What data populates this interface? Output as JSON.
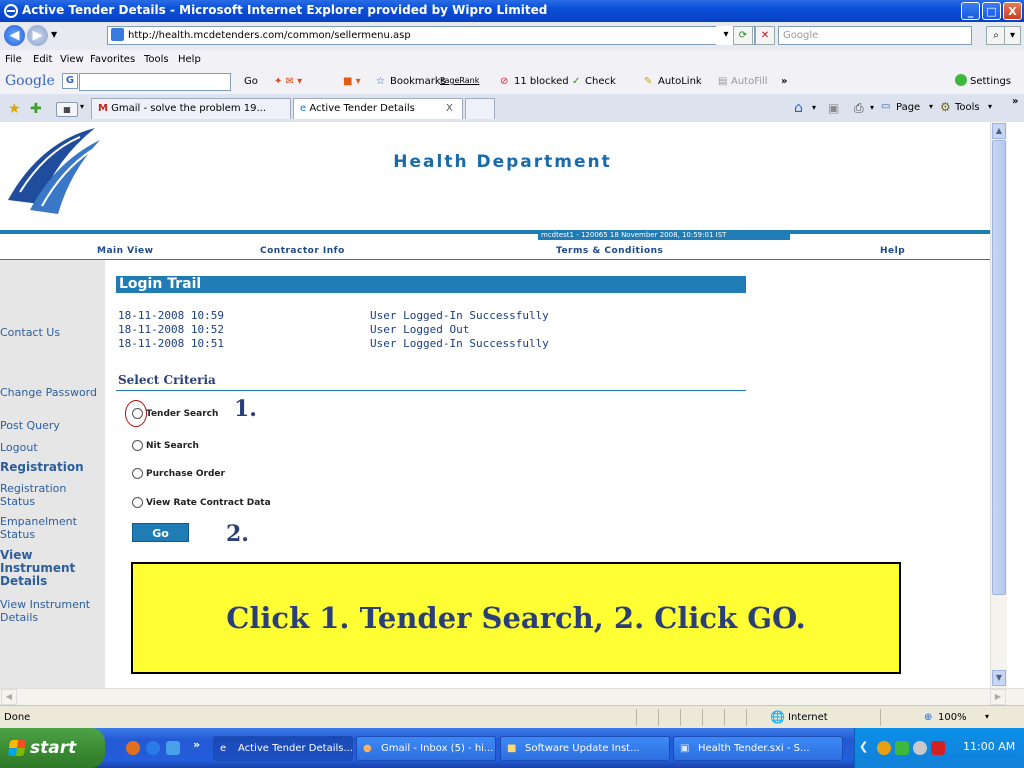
{
  "window": {
    "title": "Active Tender Details - Microsoft Internet Explorer provided by Wipro Limited",
    "minimize": "_",
    "maximize": "□",
    "close": "X"
  },
  "address": {
    "url": "http://health.mcdetenders.com/common/sellermenu.asp",
    "search_placeholder": "Google"
  },
  "menu": [
    "File",
    "Edit",
    "View",
    "Favorites",
    "Tools",
    "Help"
  ],
  "google_toolbar": {
    "logo": "Google",
    "go": "Go",
    "bookmarks": "Bookmarks",
    "pagerank": "PageRank",
    "blocked": "11 blocked",
    "check": "Check",
    "autolink": "AutoLink",
    "autofill": "AutoFill",
    "more": "»",
    "settings": "Settings"
  },
  "tabs": [
    {
      "label": "Gmail - solve the problem 19..."
    },
    {
      "label": "Active Tender Details"
    }
  ],
  "tab_close": "X",
  "command_bar": {
    "page": "Page",
    "tools": "Tools"
  },
  "site": {
    "department": "Health Department",
    "user_info": "mcdtest1 - 120065    18 November 2008, 10:59:01 IST"
  },
  "topnav": [
    "Main View",
    "Contractor Info",
    "Terms & Conditions",
    "Help"
  ],
  "sidebar": [
    {
      "label": "Contact Us",
      "big": false
    },
    {
      "label": "Change Password",
      "big": false
    },
    {
      "label": "Post Query",
      "big": false
    },
    {
      "label": "Logout",
      "big": false
    },
    {
      "label": "Registration",
      "big": true
    },
    {
      "label": "Registration Status",
      "big": false
    },
    {
      "label": "Empanelment Status",
      "big": false
    },
    {
      "label": "View Instrument Details",
      "big": true
    },
    {
      "label": "View Instrument Details",
      "big": false
    }
  ],
  "login_trail": {
    "title": "Login Trail",
    "rows": [
      {
        "time": "18-11-2008 10:59",
        "event": "User Logged-In Successfully"
      },
      {
        "time": "18-11-2008 10:52",
        "event": "User Logged Out"
      },
      {
        "time": "18-11-2008 10:51",
        "event": "User Logged-In Successfully"
      }
    ]
  },
  "criteria": {
    "title": "Select Criteria",
    "options": [
      "Tender Search",
      "Nit Search",
      "Purchase Order",
      "View Rate Contract Data"
    ],
    "go": "Go"
  },
  "annotations": {
    "step1": "1.",
    "step2": "2.",
    "callout": "Click 1. Tender Search, 2. Click GO."
  },
  "status": {
    "text": "Done",
    "zone": "Internet",
    "zoom": "100%"
  },
  "taskbar": {
    "start": "start",
    "more": "»",
    "buttons": [
      "Active Tender Details...",
      "Gmail - Inbox (5) - hi...",
      "Software Update Inst...",
      "Health Tender.sxi - S..."
    ],
    "clock": "11:00 AM"
  },
  "colors": {
    "accent": "#1f7cb5",
    "callout_bg": "#ffff33",
    "heading": "#2a3f78"
  }
}
